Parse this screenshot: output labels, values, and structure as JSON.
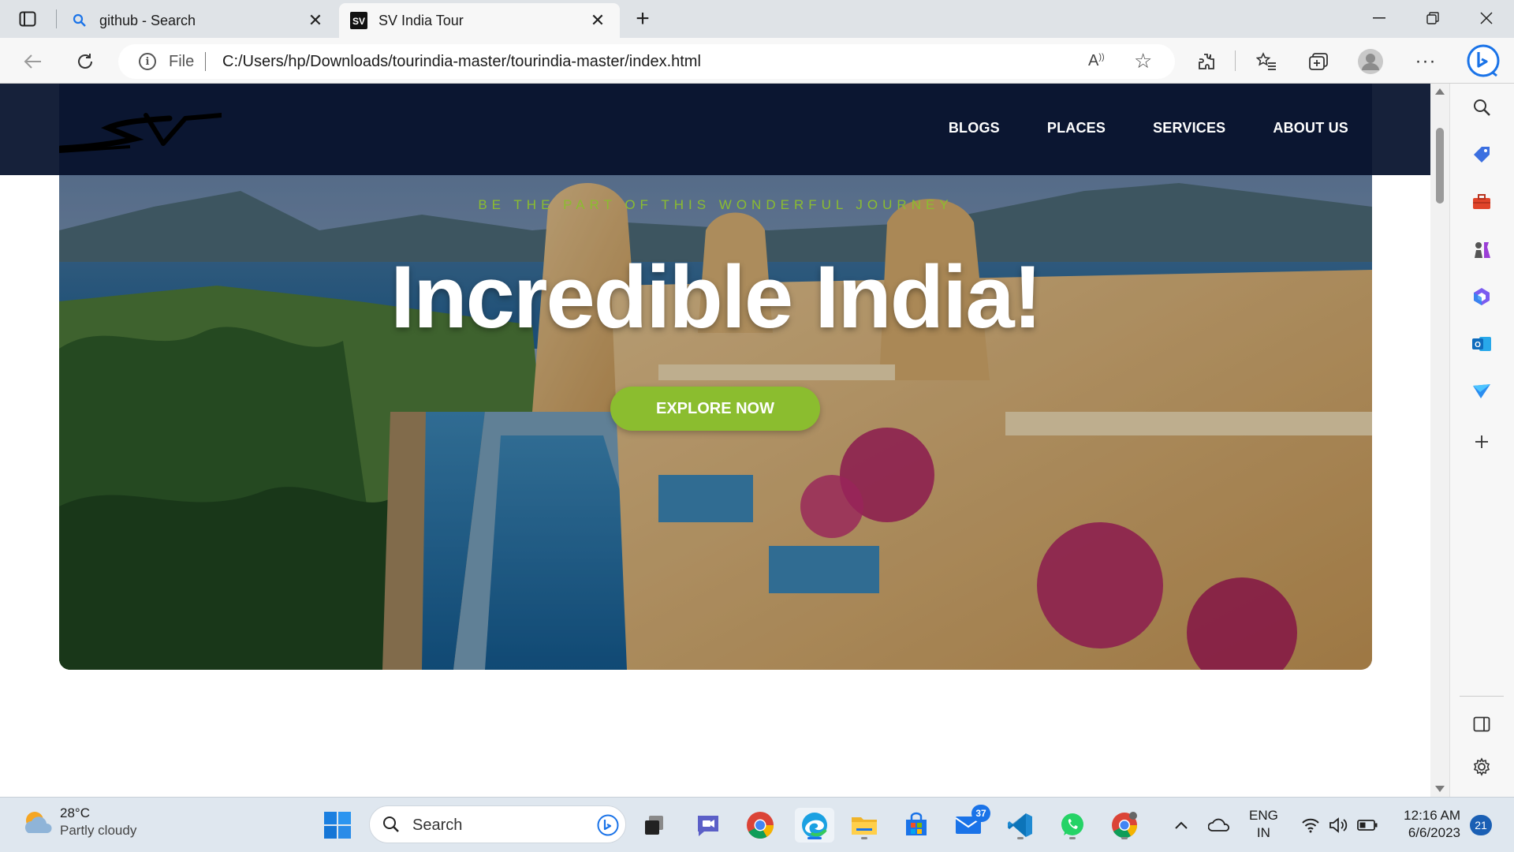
{
  "browser": {
    "tabs": [
      {
        "title": "github - Search",
        "favicon": "search-icon",
        "active": false
      },
      {
        "title": "SV India Tour",
        "favicon": "sv-logo-icon",
        "active": true
      }
    ],
    "address": {
      "scheme_label": "File",
      "url": "C:/Users/hp/Downloads/tourindia-master/tourindia-master/index.html"
    }
  },
  "site": {
    "logo_text": "SV",
    "nav": [
      "BLOGS",
      "PLACES",
      "SERVICES",
      "ABOUT US"
    ],
    "hero": {
      "tagline": "BE THE PART OF THIS WONDERFUL JOURNEY",
      "title": "Incredible India!",
      "cta": "EXPLORE NOW"
    },
    "colors": {
      "nav_bg": "#0b1631",
      "accent": "#8bbd2f",
      "title": "#ffffff"
    }
  },
  "taskbar": {
    "weather": {
      "temp": "28°C",
      "condition": "Partly cloudy"
    },
    "search_placeholder": "Search",
    "mail_badge": "37",
    "language": {
      "line1": "ENG",
      "line2": "IN"
    },
    "clock": {
      "time": "12:16 AM",
      "date": "6/6/2023"
    },
    "notifications": "21"
  }
}
